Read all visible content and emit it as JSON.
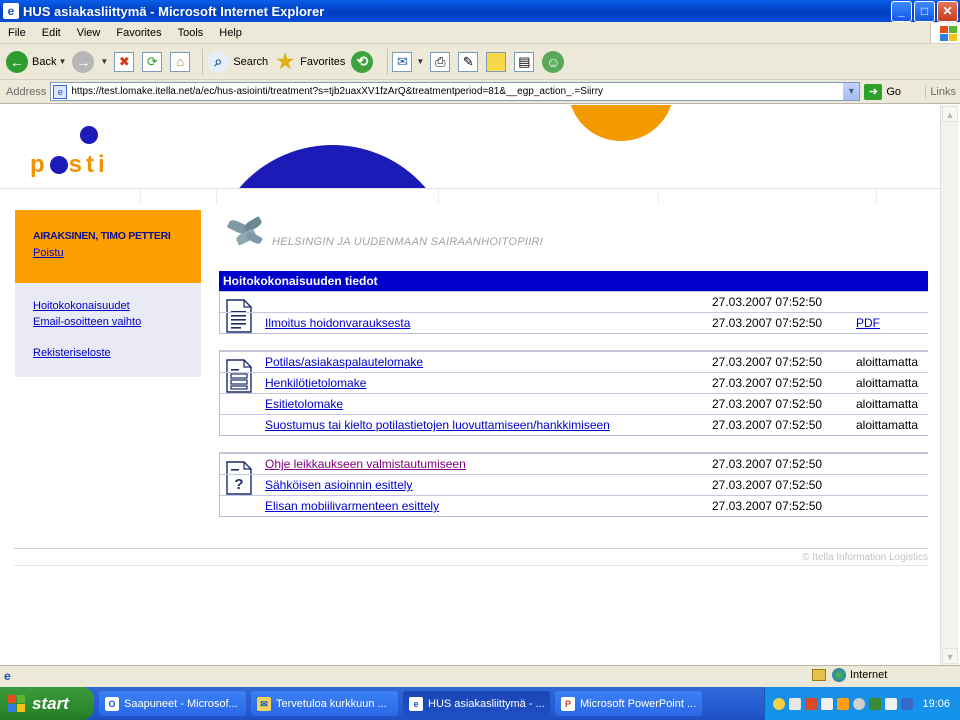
{
  "window": {
    "title": "HUS asiakasliittymä - Microsoft Internet Explorer",
    "minimize": "_",
    "maximize": "□",
    "close": "✕"
  },
  "menu": [
    "File",
    "Edit",
    "View",
    "Favorites",
    "Tools",
    "Help"
  ],
  "toolbar": {
    "back": "Back",
    "search": "Search",
    "favorites": "Favorites"
  },
  "address": {
    "label": "Address",
    "url": "https://test.lomake.itella.net/a/ec/hus-asiointi/treatment?s=tjb2uaxXV1fzArQ&treatmentperiod=81&__egp_action_.=Siirry",
    "go": "Go",
    "links": "Links"
  },
  "header": {
    "logo_left": "p",
    "logo_right": "sti"
  },
  "user": {
    "name": "AIRAKSINEN, TIMO PETTERI",
    "logout": "Poistu"
  },
  "nav": {
    "items": [
      "Hoitokokonaisuudet",
      "Email-osoitteen vaihto",
      "Rekisteriseloste"
    ]
  },
  "hospital": {
    "name": "HELSINGIN JA UUDENMAAN SAIRAANHOITOPIIRI"
  },
  "table": {
    "title": "Hoitokokonaisuuden tiedot",
    "group1": [
      {
        "name": "",
        "date": "27.03.2007 07:52:50",
        "status": ""
      },
      {
        "name": "Ilmoitus hoidonvarauksesta",
        "date": "27.03.2007 07:52:50",
        "status": "PDF"
      }
    ],
    "group2": [
      {
        "name": "Potilas/asiakaspalautelomake",
        "date": "27.03.2007 07:52:50",
        "status": "aloittamatta"
      },
      {
        "name": "Henkilötietolomake",
        "date": "27.03.2007 07:52:50",
        "status": "aloittamatta"
      },
      {
        "name": "Esitietolomake",
        "date": "27.03.2007 07:52:50",
        "status": "aloittamatta"
      },
      {
        "name": "Suostumus tai kielto potilastietojen luovuttamiseen/hankkimiseen",
        "date": "27.03.2007 07:52:50",
        "status": "aloittamatta"
      }
    ],
    "group3": [
      {
        "name": "Ohje leikkaukseen valmistautumiseen",
        "date": "27.03.2007 07:52:50",
        "status": ""
      },
      {
        "name": "Sähköisen asioinnin esittely",
        "date": "27.03.2007 07:52:50",
        "status": ""
      },
      {
        "name": "Elisan mobiilivarmenteen esittely",
        "date": "27.03.2007 07:52:50",
        "status": ""
      }
    ]
  },
  "footer": {
    "text": "© Itella Information Logistics"
  },
  "status": {
    "zone": "Internet"
  },
  "taskbar": {
    "start": "start",
    "tasks": [
      "Saapuneet - Microsof...",
      "Tervetuloa kurkkuun ...",
      "HUS asiakasliittymä - ...",
      "Microsoft PowerPoint ..."
    ],
    "clock": "19:06"
  },
  "colors": {
    "brand_orange": "#f39200",
    "brand_blue": "#1c1bb8",
    "table_header": "#0000cc",
    "link": "#0000cc",
    "visited": "#800080"
  }
}
